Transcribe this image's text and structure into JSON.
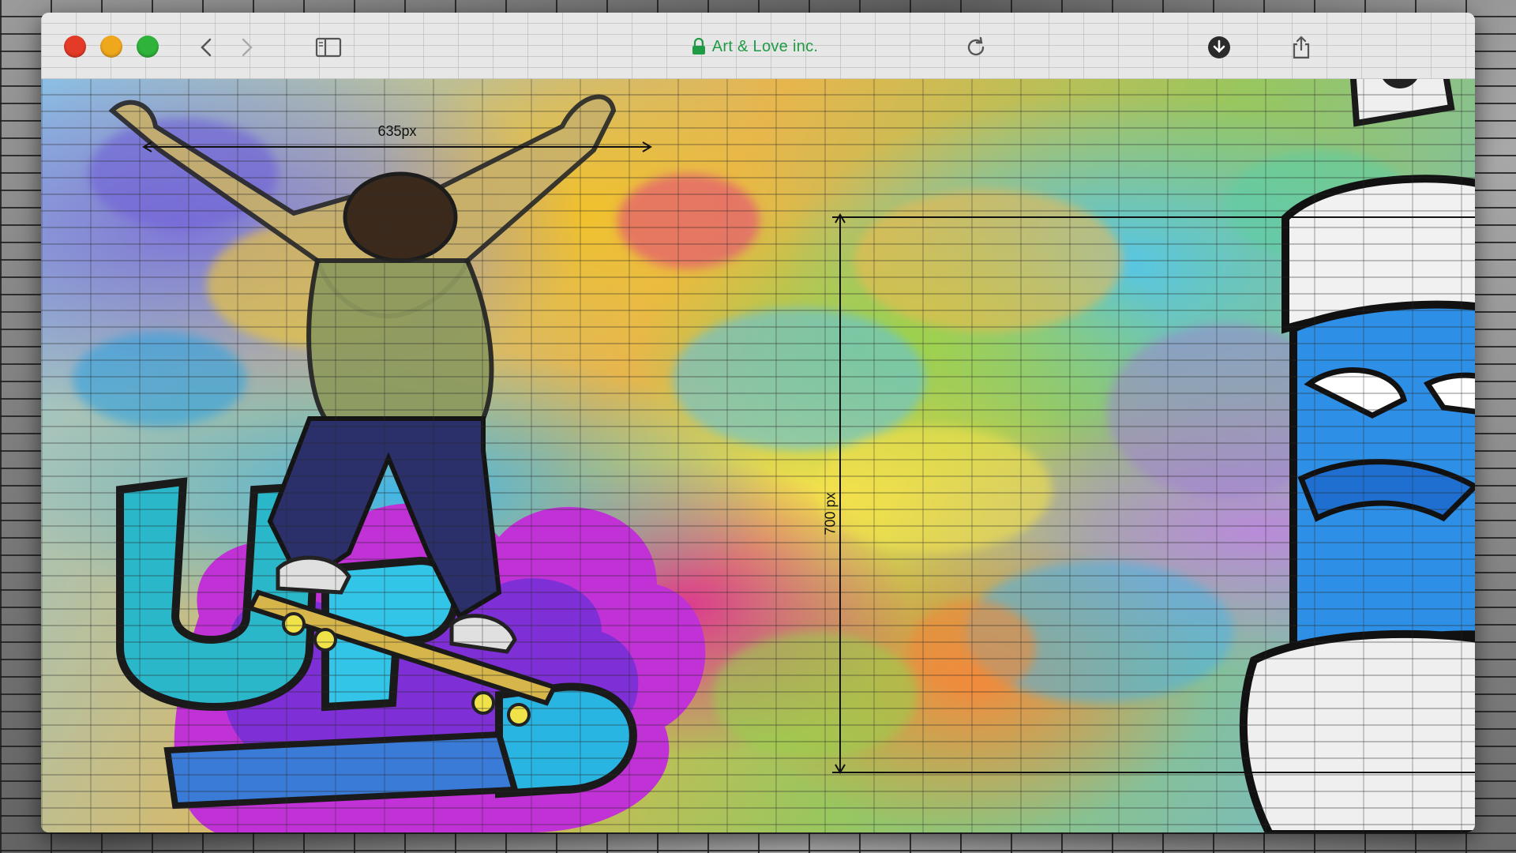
{
  "browser": {
    "address_text": "Art & Love inc.",
    "address_color": "#1f9b46",
    "traffic_lights": [
      "#e43a28",
      "#efa71c",
      "#2fb33a"
    ]
  },
  "toolbar_icons": [
    "back-icon",
    "forward-icon",
    "sidebar-icon",
    "reload-icon",
    "download-icon",
    "share-icon"
  ],
  "content": {
    "width_annotation": "635px",
    "height_annotation": "700 px"
  }
}
